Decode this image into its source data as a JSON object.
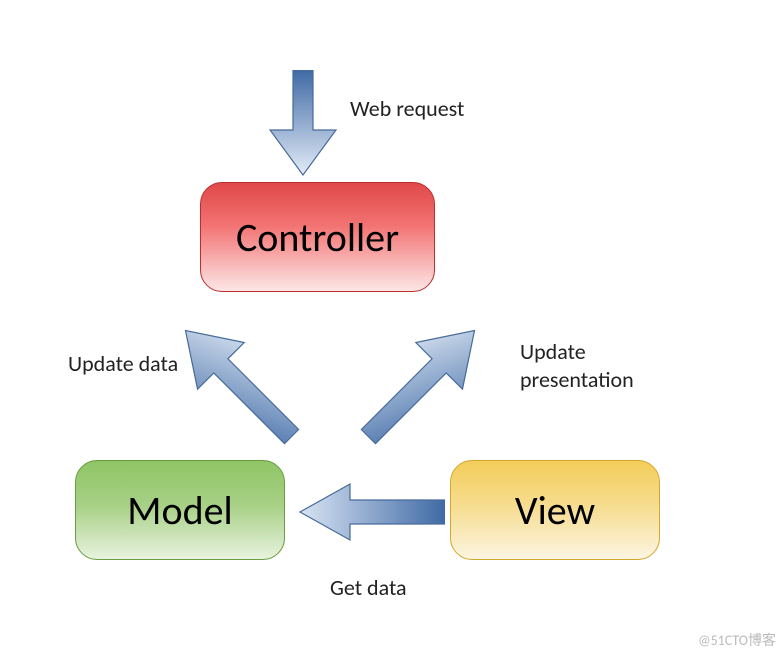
{
  "nodes": {
    "controller": "Controller",
    "model": "Model",
    "view": "View"
  },
  "edges": {
    "web_request": "Web request",
    "update_data": "Update data",
    "update_presentation_line1": "Update",
    "update_presentation_line2": "presentation",
    "get_data": "Get data"
  },
  "watermark": "@51CTO博客",
  "diagram": {
    "type": "flowchart",
    "description": "MVC pattern",
    "nodes": [
      {
        "id": "controller",
        "label": "Controller",
        "color": "red"
      },
      {
        "id": "model",
        "label": "Model",
        "color": "green"
      },
      {
        "id": "view",
        "label": "View",
        "color": "yellow"
      }
    ],
    "arrows": [
      {
        "from": "external",
        "to": "controller",
        "label": "Web request"
      },
      {
        "from": "controller",
        "to": "model",
        "label": "Update data"
      },
      {
        "from": "controller",
        "to": "view",
        "label": "Update presentation"
      },
      {
        "from": "view",
        "to": "model",
        "label": "Get data"
      }
    ],
    "colors": {
      "controller": "#e04848",
      "model": "#8fc565",
      "view": "#f3cd5a",
      "arrow_dark": "#3f6aa5",
      "arrow_light": "#d9e3f2"
    }
  }
}
